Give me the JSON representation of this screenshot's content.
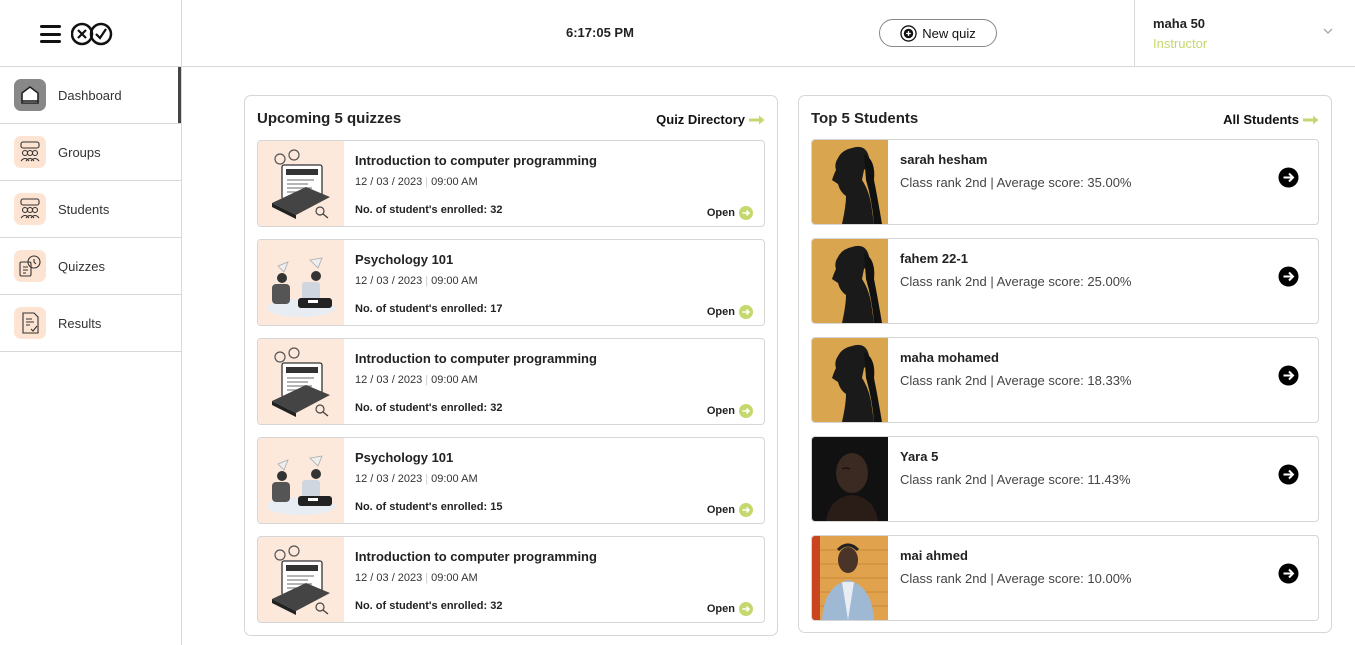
{
  "header": {
    "menu_icon": "hamburger-icon",
    "logo_icon": "xv-logo-icon",
    "clock": "6:17:05 PM",
    "new_quiz_label": "New quiz",
    "user_name": "maha 50",
    "user_role": "Instructor"
  },
  "colors": {
    "accent": "#c5d86d",
    "peach": "#fde9dc",
    "border": "#d6d6d6"
  },
  "sidebar": {
    "items": [
      {
        "label": "Dashboard",
        "icon": "home-icon",
        "active": true
      },
      {
        "label": "Groups",
        "icon": "groups-icon"
      },
      {
        "label": "Students",
        "icon": "students-icon"
      },
      {
        "label": "Quizzes",
        "icon": "quizzes-icon"
      },
      {
        "label": "Results",
        "icon": "results-icon"
      }
    ]
  },
  "quizzes": {
    "title": "Upcoming 5 quizzes",
    "link_label": "Quiz Directory",
    "open_label": "Open",
    "items": [
      {
        "title": "Introduction to computer programming",
        "date": "12 / 03 / 2023",
        "time": "09:00 AM",
        "enrolled": "No. of student's enrolled: 32",
        "thumb": "programming"
      },
      {
        "title": "Psychology 101",
        "date": "12 / 03 / 2023",
        "time": "09:00 AM",
        "enrolled": "No. of student's enrolled: 17",
        "thumb": "psychology"
      },
      {
        "title": "Introduction to computer programming",
        "date": "12 / 03 / 2023",
        "time": "09:00 AM",
        "enrolled": "No. of student's enrolled: 32",
        "thumb": "programming"
      },
      {
        "title": "Psychology 101",
        "date": "12 / 03 / 2023",
        "time": "09:00 AM",
        "enrolled": "No. of student's enrolled: 15",
        "thumb": "psychology"
      },
      {
        "title": "Introduction to computer programming",
        "date": "12 / 03 / 2023",
        "time": "09:00 AM",
        "enrolled": "No. of student's enrolled: 32",
        "thumb": "programming"
      }
    ]
  },
  "students": {
    "title": "Top 5 Students",
    "link_label": "All Students",
    "items": [
      {
        "name": "sarah hesham",
        "info": "Class rank 2nd | Average score: 35.00%",
        "photo": "woman-gold"
      },
      {
        "name": "fahem 22-1",
        "info": "Class rank 2nd | Average score: 25.00%",
        "photo": "woman-gold"
      },
      {
        "name": "maha mohamed",
        "info": "Class rank 2nd | Average score: 18.33%",
        "photo": "woman-gold"
      },
      {
        "name": "Yara 5",
        "info": "Class rank 2nd | Average score: 11.43%",
        "photo": "man-dark"
      },
      {
        "name": "mai ahmed",
        "info": "Class rank 2nd | Average score: 10.00%",
        "photo": "man-orange"
      }
    ]
  }
}
